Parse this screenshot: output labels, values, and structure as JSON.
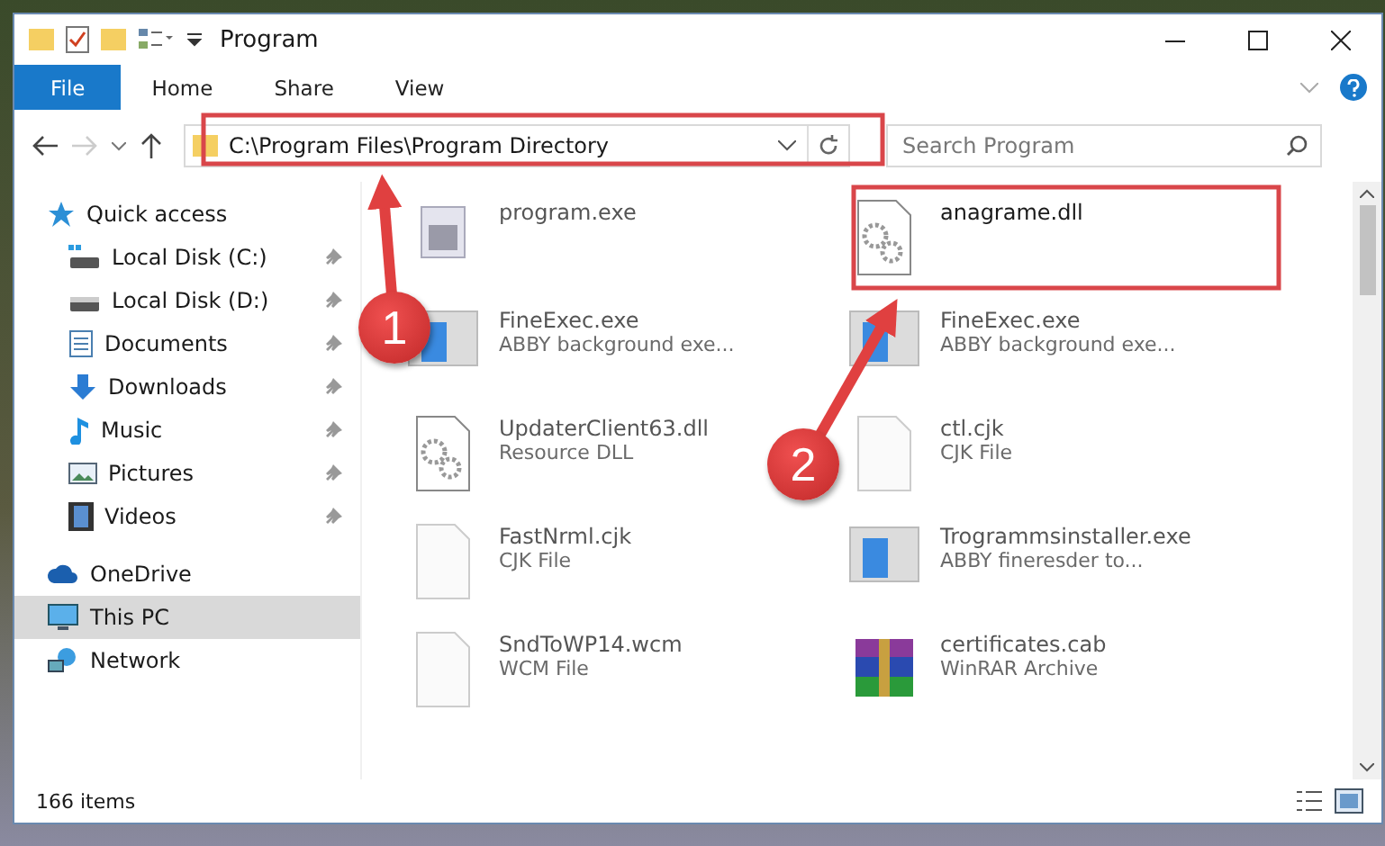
{
  "window": {
    "title": "Program"
  },
  "ribbon_tabs": [
    {
      "label": "File",
      "selected": true
    },
    {
      "label": "Home",
      "selected": false
    },
    {
      "label": "Share",
      "selected": false
    },
    {
      "label": "View",
      "selected": false
    }
  ],
  "address": {
    "path": "C:\\Program Files\\Program Directory"
  },
  "search": {
    "placeholder": "Search Program"
  },
  "sidebar": {
    "items": [
      {
        "label": "Quick access",
        "selected": false,
        "children": [
          {
            "label": "Local Disk (C:)",
            "pinned": true
          },
          {
            "label": "Local Disk (D:)",
            "pinned": true
          },
          {
            "label": "Documents",
            "pinned": true
          },
          {
            "label": "Downloads",
            "pinned": true
          },
          {
            "label": "Music",
            "pinned": true
          },
          {
            "label": "Pictures",
            "pinned": true
          },
          {
            "label": "Videos",
            "pinned": true
          }
        ]
      },
      {
        "label": "OneDrive",
        "selected": false
      },
      {
        "label": "This PC",
        "selected": true
      },
      {
        "label": "Network",
        "selected": false
      }
    ]
  },
  "files": [
    {
      "name": "program.exe",
      "kind": "exe"
    },
    {
      "name": "anagrame.dll",
      "kind": "dll"
    },
    {
      "name": "FineExec.exe",
      "type": "ABBY background exe...",
      "kind": "app"
    },
    {
      "name": "FineExec.exe",
      "type": "ABBY background exe...",
      "kind": "app"
    },
    {
      "name": "UpdaterClient63.dll",
      "type": "Resource DLL",
      "kind": "dll"
    },
    {
      "name": "ctl.cjk",
      "type": "CJK File",
      "kind": "blank"
    },
    {
      "name": "FastNrml.cjk",
      "type": "CJK File",
      "kind": "blank"
    },
    {
      "name": "Trogrammsinstaller.exe",
      "type": "ABBY fineresder to...",
      "kind": "app"
    },
    {
      "name": "SndToWP14.wcm",
      "type": "WCM File",
      "kind": "blank"
    },
    {
      "name": "certificates.cab",
      "type": "WinRAR Archive",
      "kind": "archive"
    }
  ],
  "status_bar": {
    "count": "166 items"
  },
  "annotations": [
    {
      "number": "1"
    },
    {
      "number": "2"
    }
  ]
}
